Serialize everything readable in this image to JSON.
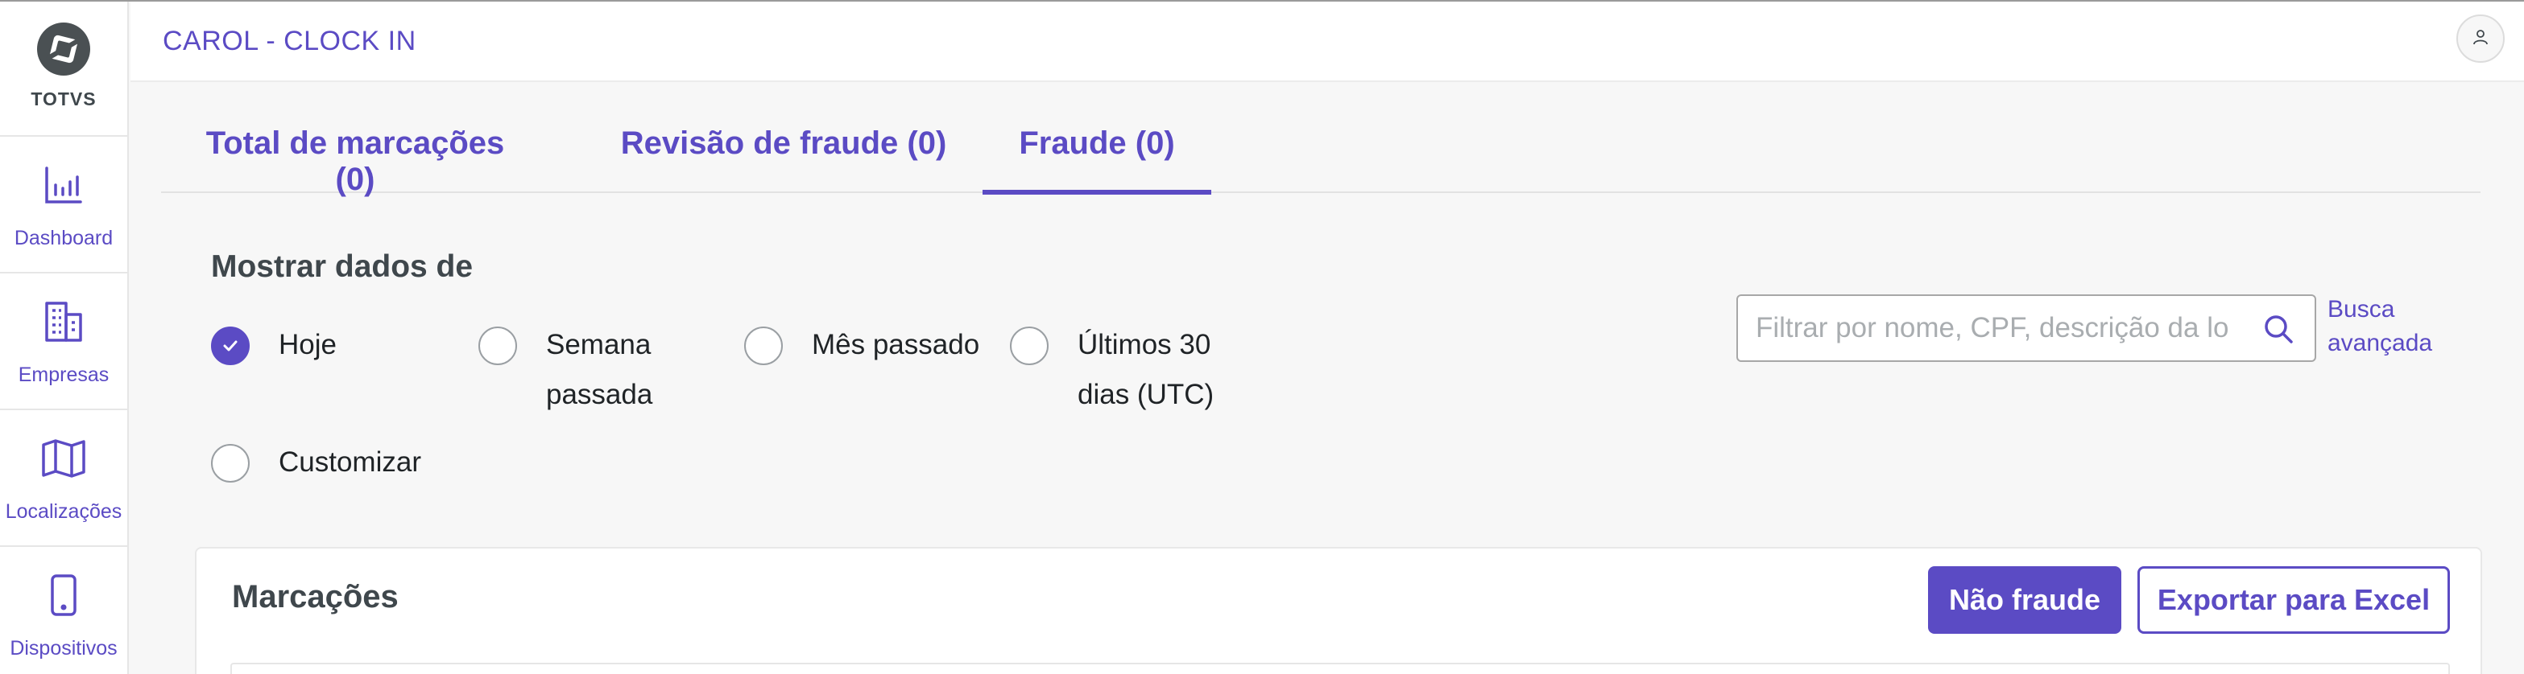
{
  "brand": {
    "name": "TOTVS"
  },
  "sidebar": {
    "items": [
      {
        "label": "Dashboard",
        "icon": "bar-chart-icon"
      },
      {
        "label": "Empresas",
        "icon": "building-icon"
      },
      {
        "label": "Localizações",
        "icon": "map-icon"
      },
      {
        "label": "Dispositivos",
        "icon": "smartphone-icon"
      }
    ]
  },
  "header": {
    "title": "CAROL - CLOCK IN"
  },
  "tabs": [
    {
      "label": "Total de marcações (0)",
      "active": false
    },
    {
      "label": "Revisão de fraude (0)",
      "active": false
    },
    {
      "label": "Fraude (0)",
      "active": true
    }
  ],
  "filters": {
    "title": "Mostrar dados de",
    "options": [
      {
        "label_lines": [
          "Hoje"
        ],
        "checked": true
      },
      {
        "label_lines": [
          "Semana",
          "passada"
        ],
        "checked": false
      },
      {
        "label_lines": [
          "Mês passado"
        ],
        "checked": false
      },
      {
        "label_lines": [
          "Últimos 30",
          "dias (UTC)"
        ],
        "checked": false
      },
      {
        "label_lines": [
          "Customizar"
        ],
        "checked": false
      }
    ],
    "search": {
      "placeholder": "Filtrar por nome, CPF, descrição da lo",
      "value": ""
    },
    "advanced": {
      "line1": "Busca",
      "line2": "avançada"
    }
  },
  "card": {
    "title": "Marcações",
    "primary_button": "Não fraude",
    "secondary_button": "Exportar para Excel"
  },
  "colors": {
    "accent": "#5b4bc4",
    "text": "#3f474c",
    "background": "#f7f7f7"
  }
}
